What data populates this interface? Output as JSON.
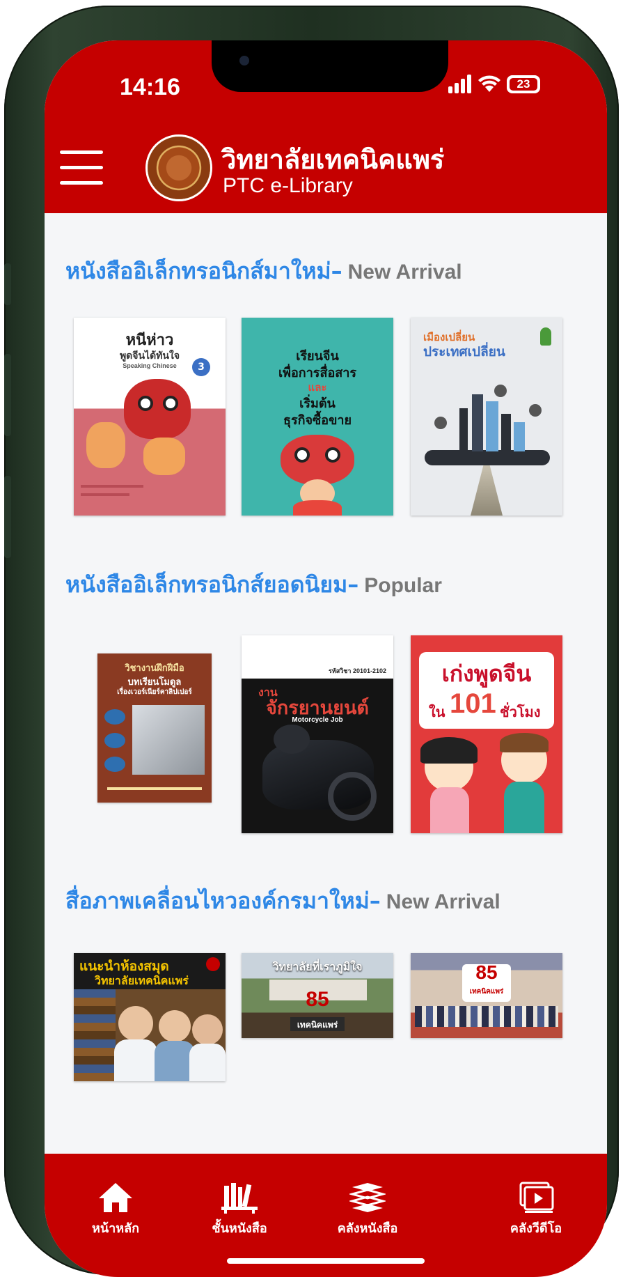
{
  "status_bar": {
    "time": "14:16",
    "battery": "23"
  },
  "header": {
    "title_th": "วิทยาลัยเทคนิคแพร่",
    "title_en": "PTC e-Library",
    "menu_icon": "hamburger-menu-icon",
    "logo": "college-seal-logo"
  },
  "sections": [
    {
      "title_th": "หนังสืออิเล็กทรอนิกส์มาใหม่",
      "dash": "–",
      "title_en": "New Arrival",
      "items": [
        {
          "lines": [
            "หนีห่าว",
            "พูดจีนได้ทันใจ",
            "Speaking Chinese",
            "3"
          ]
        },
        {
          "lines": [
            "เรียนจีน",
            "เพื่อการสื่อสาร",
            "และ",
            "เริ่มต้น",
            "ธุรกิจซื้อขาย"
          ]
        },
        {
          "lines": [
            "เมืองเปลี่ยน",
            "ประเทศเปลี่ยน"
          ]
        }
      ]
    },
    {
      "title_th": "หนังสืออิเล็กทรอนิกส์ยอดนิยม",
      "dash": "–",
      "title_en": "Popular",
      "items": [
        {
          "lines": [
            "วิชางานฝึกฝีมือ",
            "บทเรียนโมดูล",
            "เรื่องเวอร์เนียร์คาลิปเปอร์"
          ]
        },
        {
          "lines": [
            "งาน",
            "จักรยานยนต์",
            "Motorcycle Job",
            "รหัสวิชา 20101-2102"
          ]
        },
        {
          "lines": [
            "เก่งพูดจีน",
            "ใน",
            "101",
            "ชั่วโมง"
          ]
        }
      ]
    },
    {
      "title_th": "สื่อภาพเคลื่อนไหวองค์กรมาใหม่",
      "dash": "–",
      "title_en": "New Arrival",
      "items": [
        {
          "lines": [
            "แนะนำห้องสมุด",
            "วิทยาลัยเทคนิคแพร่"
          ]
        },
        {
          "lines": [
            "วิทยาลัยที่เราภูมิใจ",
            "85",
            "เทคนิคแพร่"
          ]
        },
        {
          "lines": [
            "85",
            "เทคนิคแพร่"
          ]
        }
      ]
    }
  ],
  "bottom_nav": [
    {
      "label": "หน้าหลัก",
      "icon": "home-icon"
    },
    {
      "label": "ชั้นหนังสือ",
      "icon": "bookshelf-icon"
    },
    {
      "label": "คลังหนังสือ",
      "icon": "book-stack-icon"
    },
    {
      "label": "คลังวีดีโอ",
      "icon": "video-library-icon"
    }
  ]
}
